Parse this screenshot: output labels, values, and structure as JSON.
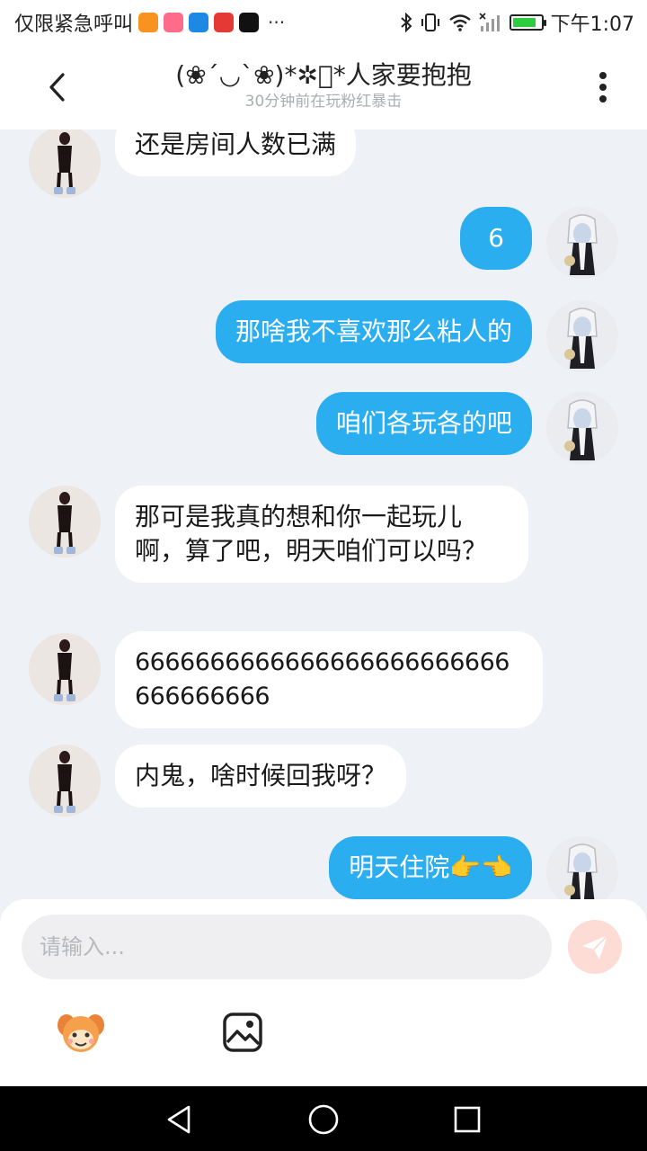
{
  "status_bar": {
    "carrier_text": "仅限紧急呼叫",
    "time": "下午1:07",
    "battery_level": 0.85,
    "app_icons": [
      "app-icon-orange",
      "app-icon-pink",
      "app-icon-blue",
      "app-icon-red",
      "tiktok-icon"
    ]
  },
  "header": {
    "title": "(❀´◡`❀)*✲ﾟ*人家要抱抱",
    "subtitle": "30分钟前在玩粉红暴击"
  },
  "messages": [
    {
      "side": "left",
      "text": "还是房间人数已满"
    },
    {
      "side": "right",
      "text": "6"
    },
    {
      "side": "right",
      "text": "那啥我不喜欢那么粘人的"
    },
    {
      "side": "right",
      "text": "咱们各玩各的吧"
    },
    {
      "side": "left",
      "text": "那可是我真的想和你一起玩儿啊，算了吧，明天咱们可以吗？"
    },
    {
      "side": "left",
      "text": "6666666666666666666666666666666666"
    },
    {
      "side": "left",
      "text": "内鬼，啥时候回我呀？"
    },
    {
      "side": "right",
      "text": "明天住院👉👈"
    }
  ],
  "composer": {
    "placeholder": "请输入...",
    "send_icon": "paper-plane-icon",
    "emoji_icon": "cartoon-character-icon",
    "image_icon": "image-icon"
  },
  "colors": {
    "outgoing_bubble": "#2aaef0",
    "incoming_bubble": "#ffffff",
    "background": "#eef1f5",
    "send_button": "#fcdcd4"
  }
}
